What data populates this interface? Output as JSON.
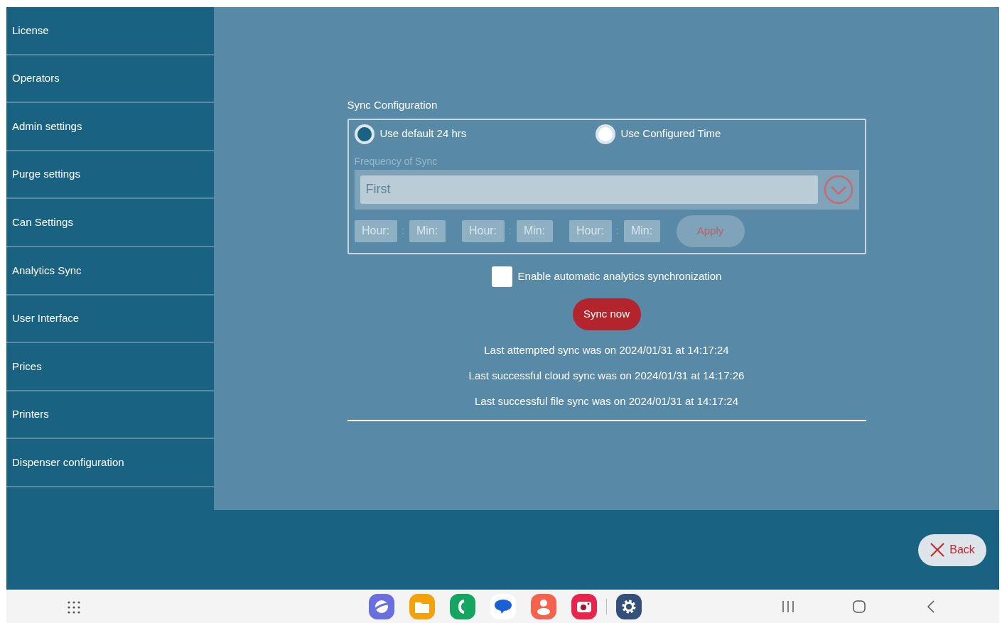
{
  "sidebar": {
    "items": [
      {
        "label": "License",
        "selected": false
      },
      {
        "label": "Operators",
        "selected": false
      },
      {
        "label": "Admin settings",
        "selected": false
      },
      {
        "label": "Purge settings",
        "selected": false
      },
      {
        "label": "Can Settings",
        "selected": false
      },
      {
        "label": "Analytics Sync",
        "selected": false
      },
      {
        "label": "User Interface",
        "selected": false
      },
      {
        "label": "Prices",
        "selected": false
      },
      {
        "label": "Printers",
        "selected": false
      },
      {
        "label": "Dispenser configuration",
        "selected": false
      }
    ]
  },
  "sync_config": {
    "title": "Sync Configuration",
    "options": [
      {
        "label": "Use default 24 hrs",
        "selected": true
      },
      {
        "label": "Use Configured Time",
        "selected": false
      }
    ],
    "frequency": {
      "label": "Frequency of Sync",
      "value": "First",
      "disabled": true
    },
    "times": [
      {
        "hour": "Hour:",
        "separator": ":",
        "minute": "Min:"
      },
      {
        "hour": "Hour:",
        "separator": ":",
        "minute": "Min:"
      },
      {
        "hour": "Hour:",
        "separator": ":",
        "minute": "Min:"
      }
    ],
    "apply_button": {
      "label": "Apply",
      "disabled": true
    }
  },
  "auto_sync": {
    "label": "Enable automatic analytics synchronization",
    "checked": false
  },
  "sync_button": {
    "label": "Sync now"
  },
  "status_lines": [
    "Last attempted sync was on 2024/01/31 at 14:17:24",
    "Last successful cloud sync was on 2024/01/31 at 14:17:26",
    "Last successful file sync was on 2024/01/31 at 14:17:24"
  ],
  "back_button": {
    "label": "Back"
  }
}
